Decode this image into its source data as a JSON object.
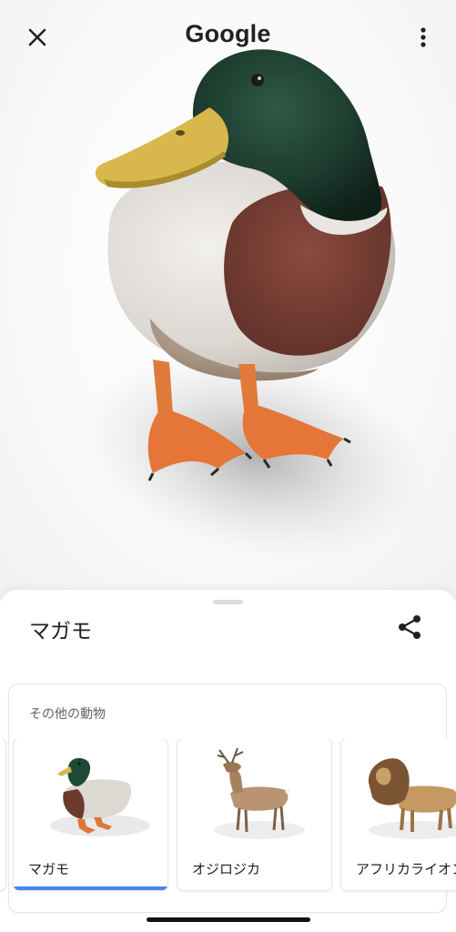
{
  "header": {
    "logo_text": "Google",
    "close_icon": "close-icon",
    "more_icon": "more-vert-icon"
  },
  "model": {
    "subject": "mallard-duck-3d-model"
  },
  "sheet": {
    "title": "マガモ",
    "share_icon": "share-icon",
    "others_label": "その他の動物",
    "animals": [
      {
        "label": "マガモ",
        "selected": true,
        "icon": "duck-thumbnail"
      },
      {
        "label": "オジロジカ",
        "selected": false,
        "icon": "deer-thumbnail"
      },
      {
        "label": "アフリカライオン",
        "selected": false,
        "icon": "lion-thumbnail"
      }
    ]
  },
  "colors": {
    "accent": "#4285f4",
    "text_primary": "#202124",
    "text_secondary": "#5f6368"
  }
}
